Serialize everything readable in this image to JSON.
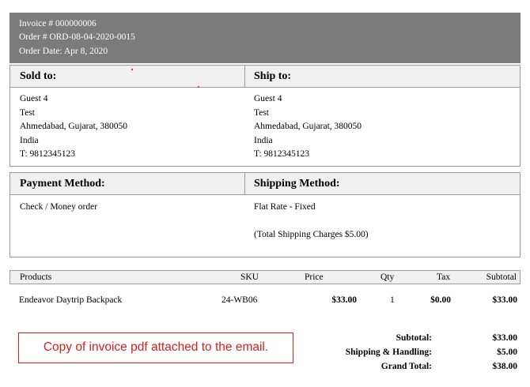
{
  "header": {
    "invoice": "Invoice # 000000006",
    "order": "Order # ORD-08-04-2020-0015",
    "date": "Order Date: Apr 8, 2020"
  },
  "sold_to": {
    "title": "Sold to:",
    "lines": [
      "Guest 4",
      "Test",
      "Ahmedabad, Gujarat, 380050",
      "India",
      "T: 9812345123"
    ]
  },
  "ship_to": {
    "title": "Ship to:",
    "lines": [
      "Guest 4",
      "Test",
      "Ahmedabad, Gujarat, 380050",
      "India",
      "T: 9812345123"
    ]
  },
  "payment": {
    "title": "Payment Method:",
    "value": "Check / Money order"
  },
  "shipping": {
    "title": "Shipping Method:",
    "value": "Flat Rate - Fixed",
    "charges": "(Total Shipping Charges $5.00)"
  },
  "items": {
    "headers": {
      "products": "Products",
      "sku": "SKU",
      "price": "Price",
      "qty": "Qty",
      "tax": "Tax",
      "subtotal": "Subtotal"
    },
    "rows": [
      {
        "product": "Endeavor Daytrip Backpack",
        "sku": "24-WB06",
        "price": "$33.00",
        "qty": "1",
        "tax": "$0.00",
        "subtotal": "$33.00"
      }
    ]
  },
  "totals": {
    "subtotal_label": "Subtotal:",
    "subtotal_value": "$33.00",
    "shipping_label": "Shipping & Handling:",
    "shipping_value": "$5.00",
    "grand_label": "Grand Total:",
    "grand_value": "$38.00"
  },
  "note": "Copy of invoice pdf attached to the email.",
  "colors": {
    "header_bg": "#7b7b7b",
    "note_border": "#d62020",
    "section_bg": "#f0f0f0"
  }
}
